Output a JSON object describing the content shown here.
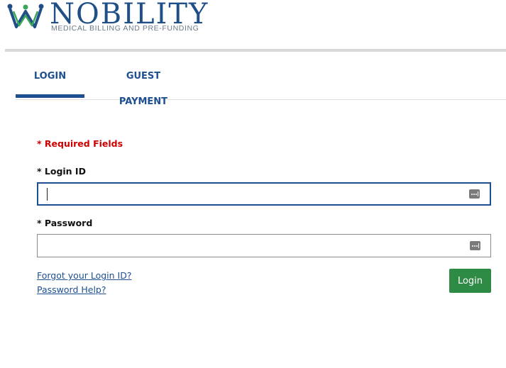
{
  "brand": {
    "name": "NOBILITY",
    "tagline": "MEDICAL BILLING AND PRE-FUNDING",
    "logo_icon": "crown-w-logo-icon",
    "primary_color": "#1d4f91",
    "accent_color": "#3aa65a"
  },
  "tabs": [
    {
      "label": "LOGIN",
      "active": true
    },
    {
      "label": "GUEST PAYMENT",
      "active": false
    }
  ],
  "form": {
    "required_note": "* Required Fields",
    "login_id": {
      "label": "* Login ID",
      "value": "",
      "placeholder": ""
    },
    "password": {
      "label": "* Password",
      "value": "",
      "placeholder": ""
    },
    "field_icon": "password-manager-key-icon",
    "forgot_login_link": "Forgot your Login ID?",
    "password_help_link": "Password Help?",
    "submit_label": "Login",
    "submit_color": "#2e8b45",
    "required_color": "#cc0000"
  }
}
